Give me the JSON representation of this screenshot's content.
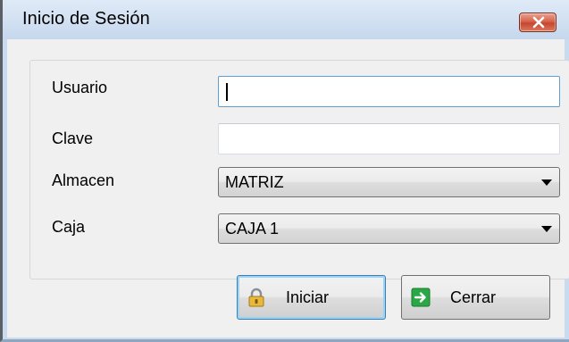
{
  "window": {
    "title": "Inicio de Sesión"
  },
  "form": {
    "usuario": {
      "label": "Usuario",
      "value": ""
    },
    "clave": {
      "label": "Clave",
      "value": ""
    },
    "almacen": {
      "label": "Almacen",
      "selected": "MATRIZ"
    },
    "caja": {
      "label": "Caja",
      "selected": "CAJA 1"
    }
  },
  "buttons": {
    "iniciar": {
      "label": "Iniciar",
      "icon": "lock-icon"
    },
    "cerrar": {
      "label": "Cerrar",
      "icon": "exit-arrow-icon"
    }
  },
  "colors": {
    "close_button": "#d7634c",
    "exit_icon": "#2aa845",
    "lock_icon": "#e0b23a"
  }
}
